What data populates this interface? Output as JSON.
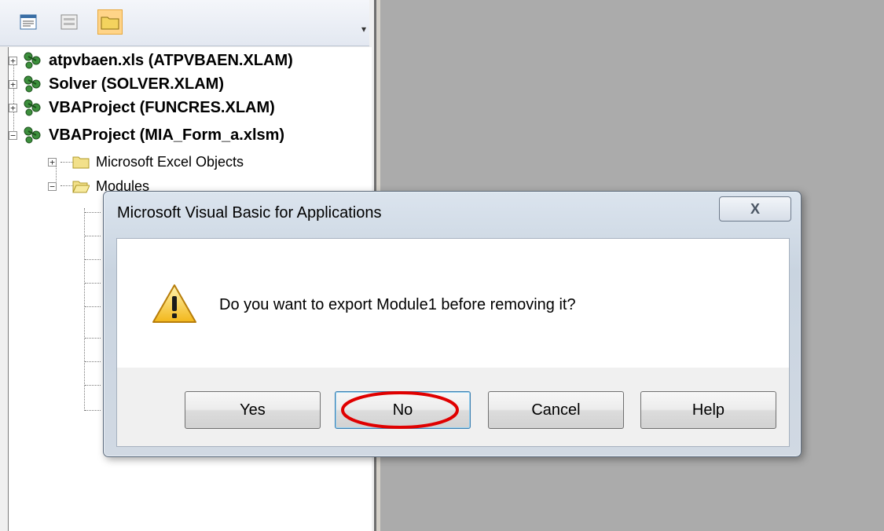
{
  "explorer": {
    "projects": [
      {
        "label": "atpvbaen.xls (ATPVBAEN.XLAM)",
        "expander": "+"
      },
      {
        "label": "Solver (SOLVER.XLAM)",
        "expander": "+"
      },
      {
        "label": "VBAProject (FUNCRES.XLAM)",
        "expander": "+"
      },
      {
        "label": "VBAProject (MIA_Form_a.xlsm)",
        "expander": "−"
      }
    ],
    "folders": [
      {
        "label": "Microsoft Excel Objects",
        "expander": "+"
      },
      {
        "label": "Modules",
        "expander": "−"
      }
    ]
  },
  "dialog": {
    "title": "Microsoft Visual Basic for Applications",
    "close_glyph": "X",
    "message": "Do you want to export Module1 before removing it?",
    "icon": "warning-icon",
    "buttons": [
      {
        "label": "Yes"
      },
      {
        "label": "No"
      },
      {
        "label": "Cancel"
      },
      {
        "label": "Help"
      }
    ]
  },
  "annotation": {
    "color": "#e00000",
    "target": "No"
  },
  "colors": {
    "background": "#ababab",
    "selected_toolbar": "#ffd488"
  }
}
